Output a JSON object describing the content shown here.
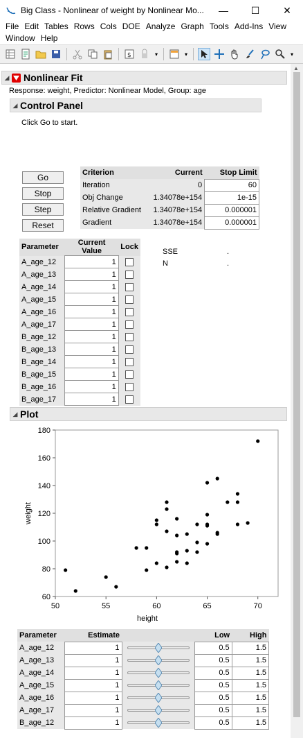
{
  "window": {
    "title": "Big Class - Nonlinear of weight by Nonlinear Mo...",
    "minimize": "—",
    "maximize": "☐",
    "close": "✕"
  },
  "menu": [
    "File",
    "Edit",
    "Tables",
    "Rows",
    "Cols",
    "DOE",
    "Analyze",
    "Graph",
    "Tools",
    "Add-Ins",
    "View",
    "Window",
    "Help"
  ],
  "report": {
    "title": "Nonlinear Fit",
    "subtitle": "Response: weight, Predictor: Nonlinear Model, Group: age"
  },
  "control_panel": {
    "title": "Control Panel",
    "message": "Click Go to start.",
    "buttons": [
      "Go",
      "Stop",
      "Step",
      "Reset"
    ],
    "criterion_headers": [
      "Criterion",
      "Current",
      "Stop Limit"
    ],
    "criteria": [
      {
        "name": "Iteration",
        "current": "0",
        "limit": "60"
      },
      {
        "name": "Obj Change",
        "current": "1.34078e+154",
        "limit": "1e-15"
      },
      {
        "name": "Relative Gradient",
        "current": "1.34078e+154",
        "limit": "0.000001"
      },
      {
        "name": "Gradient",
        "current": "1.34078e+154",
        "limit": "0.000001"
      }
    ],
    "param_headers": [
      "Parameter",
      "Current Value",
      "Lock"
    ],
    "params": [
      {
        "name": "A_age_12",
        "value": "1"
      },
      {
        "name": "A_age_13",
        "value": "1"
      },
      {
        "name": "A_age_14",
        "value": "1"
      },
      {
        "name": "A_age_15",
        "value": "1"
      },
      {
        "name": "A_age_16",
        "value": "1"
      },
      {
        "name": "A_age_17",
        "value": "1"
      },
      {
        "name": "B_age_12",
        "value": "1"
      },
      {
        "name": "B_age_13",
        "value": "1"
      },
      {
        "name": "B_age_14",
        "value": "1"
      },
      {
        "name": "B_age_15",
        "value": "1"
      },
      {
        "name": "B_age_16",
        "value": "1"
      },
      {
        "name": "B_age_17",
        "value": "1"
      }
    ],
    "stats": [
      {
        "label": "SSE",
        "value": "."
      },
      {
        "label": "N",
        "value": "."
      }
    ]
  },
  "plot": {
    "title": "Plot"
  },
  "chart_data": {
    "type": "scatter",
    "xlabel": "height",
    "ylabel": "weight",
    "xlim": [
      50,
      72
    ],
    "ylim": [
      60,
      180
    ],
    "xticks": [
      50,
      55,
      60,
      65,
      70
    ],
    "yticks": [
      60,
      80,
      100,
      120,
      140,
      160,
      180
    ],
    "grid": false,
    "points": [
      [
        51,
        79
      ],
      [
        52,
        64
      ],
      [
        55,
        74
      ],
      [
        56,
        67
      ],
      [
        58,
        95
      ],
      [
        59,
        79
      ],
      [
        59,
        95
      ],
      [
        60,
        84
      ],
      [
        60,
        112
      ],
      [
        60,
        115
      ],
      [
        61,
        81
      ],
      [
        61,
        107
      ],
      [
        61,
        123
      ],
      [
        61,
        128
      ],
      [
        62,
        85
      ],
      [
        62,
        91
      ],
      [
        62,
        92
      ],
      [
        62,
        104
      ],
      [
        62,
        116
      ],
      [
        63,
        84
      ],
      [
        63,
        93
      ],
      [
        63,
        105
      ],
      [
        64,
        92
      ],
      [
        64,
        99
      ],
      [
        64,
        112
      ],
      [
        65,
        98
      ],
      [
        65,
        111
      ],
      [
        65,
        112
      ],
      [
        65,
        119
      ],
      [
        65,
        142
      ],
      [
        66,
        105
      ],
      [
        66,
        106
      ],
      [
        66,
        145
      ],
      [
        67,
        128
      ],
      [
        68,
        112
      ],
      [
        68,
        128
      ],
      [
        68,
        134
      ],
      [
        69,
        113
      ],
      [
        70,
        172
      ]
    ]
  },
  "estimates": {
    "headers": [
      "Parameter",
      "Estimate",
      "",
      "Low",
      "High"
    ],
    "rows": [
      {
        "name": "A_age_12",
        "estimate": "1",
        "low": "0.5",
        "high": "1.5",
        "pos": 0.5
      },
      {
        "name": "A_age_13",
        "estimate": "1",
        "low": "0.5",
        "high": "1.5",
        "pos": 0.5
      },
      {
        "name": "A_age_14",
        "estimate": "1",
        "low": "0.5",
        "high": "1.5",
        "pos": 0.5
      },
      {
        "name": "A_age_15",
        "estimate": "1",
        "low": "0.5",
        "high": "1.5",
        "pos": 0.5
      },
      {
        "name": "A_age_16",
        "estimate": "1",
        "low": "0.5",
        "high": "1.5",
        "pos": 0.5
      },
      {
        "name": "A_age_17",
        "estimate": "1",
        "low": "0.5",
        "high": "1.5",
        "pos": 0.5
      },
      {
        "name": "B_age_12",
        "estimate": "1",
        "low": "0.5",
        "high": "1.5",
        "pos": 0.5
      }
    ]
  },
  "colors": {
    "accent": "#e00000",
    "slider_thumb": "#c6dff0"
  }
}
